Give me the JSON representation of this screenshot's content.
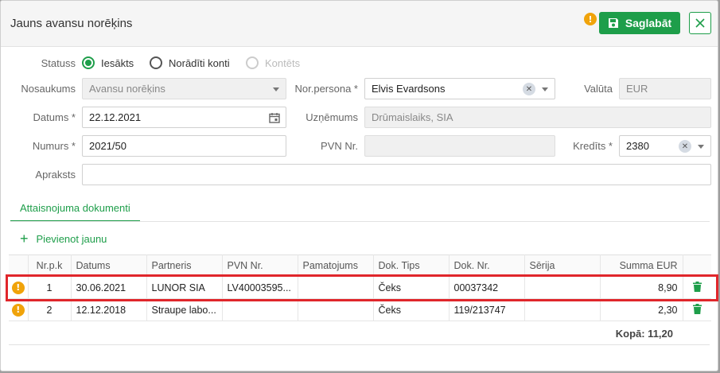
{
  "dialog": {
    "title": "Jauns avansu norēķins",
    "warn_glyph": "!",
    "save_label": "Saglabāt",
    "close_glyph": "✕"
  },
  "status": {
    "label": "Statuss",
    "options": [
      "Iesākts",
      "Norādīti konti",
      "Kontēts"
    ],
    "selected": "Iesākts"
  },
  "form": {
    "name_label": "Nosaukums",
    "name_value": "Avansu norēķins",
    "date_label": "Datums *",
    "date_value": "22.12.2021",
    "number_label": "Numurs *",
    "number_value": "2021/50",
    "description_label": "Apraksts",
    "description_value": "",
    "person_label": "Nor.persona *",
    "person_value": "Elvis Evardsons",
    "company_label": "Uzņēmums",
    "company_value": "Drūmaislaiks, SIA",
    "vat_label": "PVN Nr.",
    "vat_value": "",
    "currency_label": "Valūta",
    "currency_value": "EUR",
    "credit_label": "Kredīts *",
    "credit_value": "2380",
    "clear_glyph": "✕"
  },
  "tabs": {
    "active": "Attaisnojuma dokumenti"
  },
  "add_new": {
    "plus": "+",
    "label": "Pievienot jaunu"
  },
  "table": {
    "columns": [
      "",
      "Nr.p.k",
      "Datums",
      "Partneris",
      "PVN Nr.",
      "Pamatojums",
      "Dok. Tips",
      "Dok. Nr.",
      "Sērija",
      "Summa EUR",
      ""
    ],
    "rows": [
      {
        "warn": "!",
        "nr": "1",
        "date": "30.06.2021",
        "partner": "LUNOR SIA",
        "vat": "LV40003595...",
        "reason": "",
        "doc_type": "Čeks",
        "doc_nr": "00037342",
        "series": "",
        "amount": "8,90"
      },
      {
        "warn": "!",
        "nr": "2",
        "date": "12.12.2018",
        "partner": "Straupe labo...",
        "vat": "",
        "reason": "",
        "doc_type": "Čeks",
        "doc_nr": "119/213747",
        "series": "",
        "amount": "2,30"
      }
    ],
    "total": "Kopā: 11,20"
  },
  "colors": {
    "accent": "#1e9e4a",
    "warning": "#f0a30a",
    "highlight": "#e0262b"
  }
}
